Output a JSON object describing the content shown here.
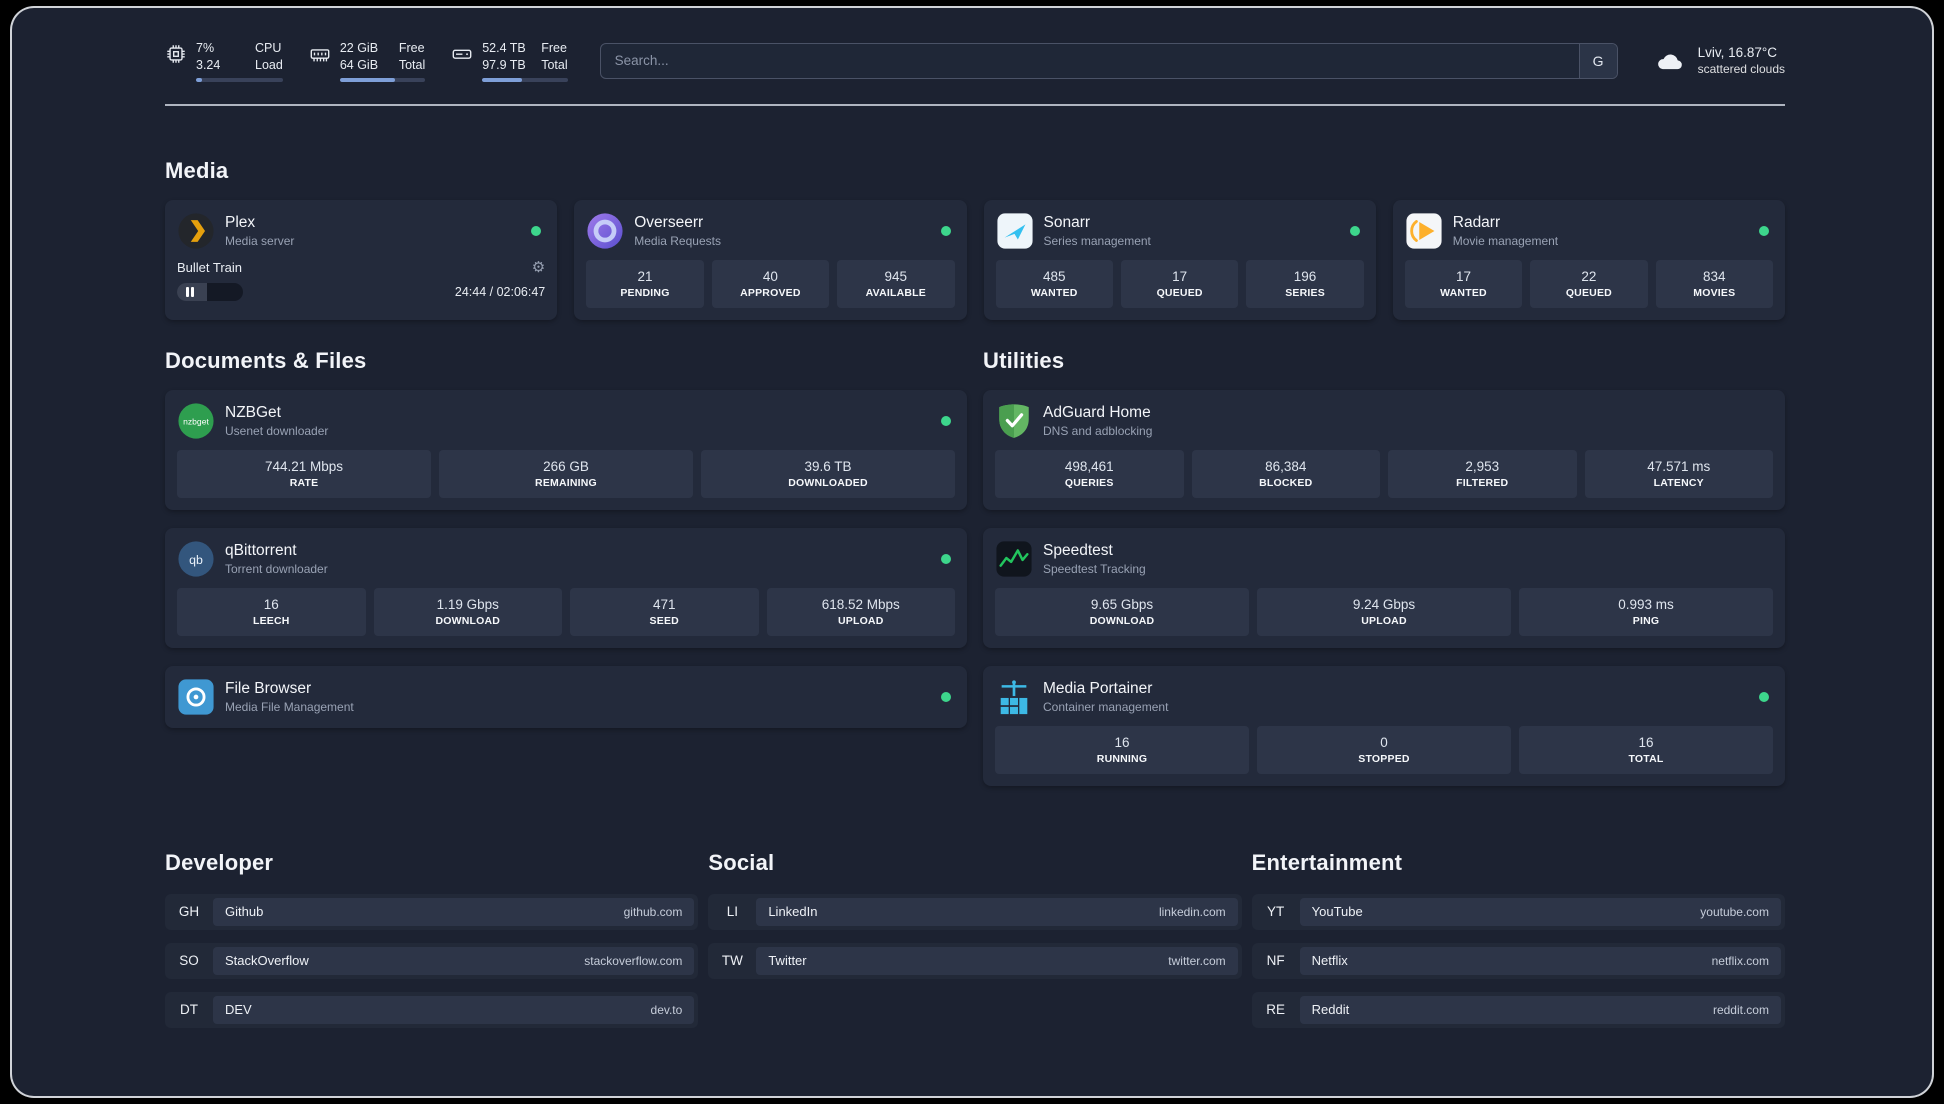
{
  "colors": {
    "background": "#1c2231",
    "card": "#232a3b",
    "tile": "#2d3548",
    "status_online": "#3dd68c",
    "accent_bar": "#7e9fd8",
    "divider": "#c9cfd9"
  },
  "icons": {
    "gear": "⚙"
  },
  "topbar": {
    "metrics": [
      {
        "icon": "cpu-icon",
        "value1": "7%",
        "value2": "3.24",
        "label1": "CPU",
        "label2": "Load",
        "fraction": 0.07
      },
      {
        "icon": "ram-icon",
        "value1": "22 GiB",
        "value2": "64 GiB",
        "label1": "Free",
        "label2": "Total",
        "fraction": 0.65
      },
      {
        "icon": "disk-icon",
        "value1": "52.4 TB",
        "value2": "97.9 TB",
        "label1": "Free",
        "label2": "Total",
        "fraction": 0.46
      }
    ],
    "search": {
      "placeholder": "Search...",
      "engine_label": "G"
    },
    "weather": {
      "location": "Lviv, 16.87°C",
      "condition": "scattered clouds"
    }
  },
  "sections": {
    "media": {
      "title": "Media",
      "plex": {
        "name": "Plex",
        "desc": "Media server",
        "now_playing": "Bullet Train",
        "time": "24:44 / 02:06:47",
        "progress": 0.45
      },
      "overseerr": {
        "name": "Overseerr",
        "desc": "Media Requests",
        "stats": [
          {
            "value": "21",
            "label": "PENDING"
          },
          {
            "value": "40",
            "label": "APPROVED"
          },
          {
            "value": "945",
            "label": "AVAILABLE"
          }
        ]
      },
      "sonarr": {
        "name": "Sonarr",
        "desc": "Series management",
        "stats": [
          {
            "value": "485",
            "label": "WANTED"
          },
          {
            "value": "17",
            "label": "QUEUED"
          },
          {
            "value": "196",
            "label": "SERIES"
          }
        ]
      },
      "radarr": {
        "name": "Radarr",
        "desc": "Movie management",
        "stats": [
          {
            "value": "17",
            "label": "WANTED"
          },
          {
            "value": "22",
            "label": "QUEUED"
          },
          {
            "value": "834",
            "label": "MOVIES"
          }
        ]
      }
    },
    "documents": {
      "title": "Documents & Files",
      "nzbget": {
        "name": "NZBGet",
        "desc": "Usenet downloader",
        "stats": [
          {
            "value": "744.21 Mbps",
            "label": "RATE"
          },
          {
            "value": "266 GB",
            "label": "REMAINING"
          },
          {
            "value": "39.6 TB",
            "label": "DOWNLOADED"
          }
        ]
      },
      "qbittorrent": {
        "name": "qBittorrent",
        "desc": "Torrent downloader",
        "stats": [
          {
            "value": "16",
            "label": "LEECH"
          },
          {
            "value": "1.19 Gbps",
            "label": "DOWNLOAD"
          },
          {
            "value": "471",
            "label": "SEED"
          },
          {
            "value": "618.52 Mbps",
            "label": "UPLOAD"
          }
        ]
      },
      "filebrowser": {
        "name": "File Browser",
        "desc": "Media File Management"
      }
    },
    "utilities": {
      "title": "Utilities",
      "adguard": {
        "name": "AdGuard Home",
        "desc": "DNS and adblocking",
        "stats": [
          {
            "value": "498,461",
            "label": "QUERIES"
          },
          {
            "value": "86,384",
            "label": "BLOCKED"
          },
          {
            "value": "2,953",
            "label": "FILTERED"
          },
          {
            "value": "47.571 ms",
            "label": "LATENCY"
          }
        ]
      },
      "speedtest": {
        "name": "Speedtest",
        "desc": "Speedtest Tracking",
        "stats": [
          {
            "value": "9.65 Gbps",
            "label": "DOWNLOAD"
          },
          {
            "value": "9.24 Gbps",
            "label": "UPLOAD"
          },
          {
            "value": "0.993 ms",
            "label": "PING"
          }
        ]
      },
      "portainer": {
        "name": "Media Portainer",
        "desc": "Container management",
        "stats": [
          {
            "value": "16",
            "label": "RUNNING"
          },
          {
            "value": "0",
            "label": "STOPPED"
          },
          {
            "value": "16",
            "label": "TOTAL"
          }
        ]
      }
    },
    "bookmarks": [
      {
        "title": "Developer",
        "items": [
          {
            "abbr": "GH",
            "name": "Github",
            "url": "github.com"
          },
          {
            "abbr": "SO",
            "name": "StackOverflow",
            "url": "stackoverflow.com"
          },
          {
            "abbr": "DT",
            "name": "DEV",
            "url": "dev.to"
          }
        ]
      },
      {
        "title": "Social",
        "items": [
          {
            "abbr": "LI",
            "name": "LinkedIn",
            "url": "linkedin.com"
          },
          {
            "abbr": "TW",
            "name": "Twitter",
            "url": "twitter.com"
          }
        ]
      },
      {
        "title": "Entertainment",
        "items": [
          {
            "abbr": "YT",
            "name": "YouTube",
            "url": "youtube.com"
          },
          {
            "abbr": "NF",
            "name": "Netflix",
            "url": "netflix.com"
          },
          {
            "abbr": "RE",
            "name": "Reddit",
            "url": "reddit.com"
          }
        ]
      }
    ]
  }
}
